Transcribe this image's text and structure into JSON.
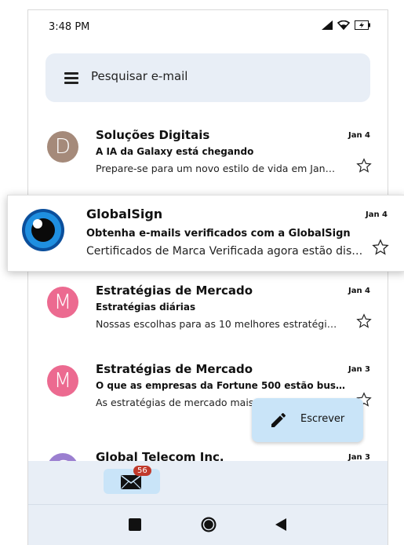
{
  "status_bar": {
    "time": "3:48 PM"
  },
  "search": {
    "placeholder": "Pesquisar e-mail"
  },
  "emails": [
    {
      "avatar_letter": "D",
      "avatar_color": "#a58a7a",
      "sender": "Soluções Digitais",
      "subject": "A IA da Galaxy está chegando",
      "preview": "Prepare-se para um novo estilo de vida em Janeiro...",
      "date": "Jan 4"
    },
    {
      "avatar_letter": "M",
      "avatar_color": "#ec6a90",
      "sender": "Estratégias de Mercado",
      "subject": "Estratégias diárias",
      "preview": "Nossas escolhas para as 10 melhores estratégias do dia",
      "date": "Jan 4"
    },
    {
      "avatar_letter": "M",
      "avatar_color": "#ec6a90",
      "sender": "Estratégias de Mercado",
      "subject": "O que as empresas da Fortune 500 estão buscando",
      "preview": "As estratégias de mercado mais",
      "date": "Jan 3"
    },
    {
      "avatar_letter": "G",
      "avatar_color": "#9b7fd0",
      "sender": "Global Telecom Inc.",
      "subject": "",
      "preview": "",
      "date": "Jan 3"
    }
  ],
  "popup_email": {
    "sender": "GlobalSign",
    "subject": "Obtenha e-mails verificados com a GlobalSign",
    "preview": "Certificados de Marca Verificada agora estão disponíveis",
    "date": "Jan 4"
  },
  "fab": {
    "label": "Escrever"
  },
  "bottom_nav": {
    "mail_badge": "56"
  }
}
